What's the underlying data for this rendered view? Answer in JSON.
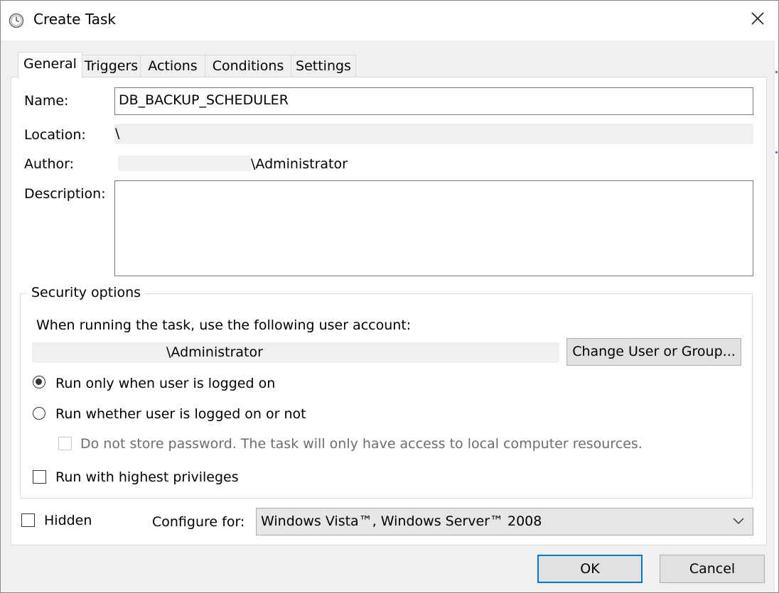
{
  "window": {
    "title": "Create Task",
    "title_icon": "clock-icon",
    "close_icon": "close-icon"
  },
  "tabs": [
    {
      "label": "General",
      "active": true
    },
    {
      "label": "Triggers",
      "active": false
    },
    {
      "label": "Actions",
      "active": false
    },
    {
      "label": "Conditions",
      "active": false
    },
    {
      "label": "Settings",
      "active": false
    }
  ],
  "general": {
    "name_label": "Name:",
    "name_value": "DB_BACKUP_SCHEDULER",
    "location_label": "Location:",
    "location_value": "\\",
    "author_label": "Author:",
    "author_value": "\\Administrator",
    "description_label": "Description:",
    "description_value": ""
  },
  "security": {
    "group_title": "Security options",
    "account_prompt": "When running the task, use the following user account:",
    "account_value": "\\Administrator",
    "change_button": "Change User or Group...",
    "radio_logged_on": "Run only when user is logged on",
    "radio_logged_on_selected": true,
    "radio_whether": "Run whether user is logged on or not",
    "radio_whether_selected": false,
    "no_store_password": "Do not store password.  The task will only have access to local computer resources.",
    "no_store_password_checked": false,
    "highest_privileges": "Run with highest privileges",
    "highest_privileges_checked": false
  },
  "bottom": {
    "hidden_label": "Hidden",
    "hidden_checked": false,
    "configure_label": "Configure for:",
    "configure_value": "Windows Vista™, Windows Server™ 2008"
  },
  "buttons": {
    "ok": "OK",
    "cancel": "Cancel"
  },
  "colors": {
    "accent": "#0078d7",
    "dialog_bg": "#f0f0f0",
    "panel_bg": "#ffffff"
  }
}
